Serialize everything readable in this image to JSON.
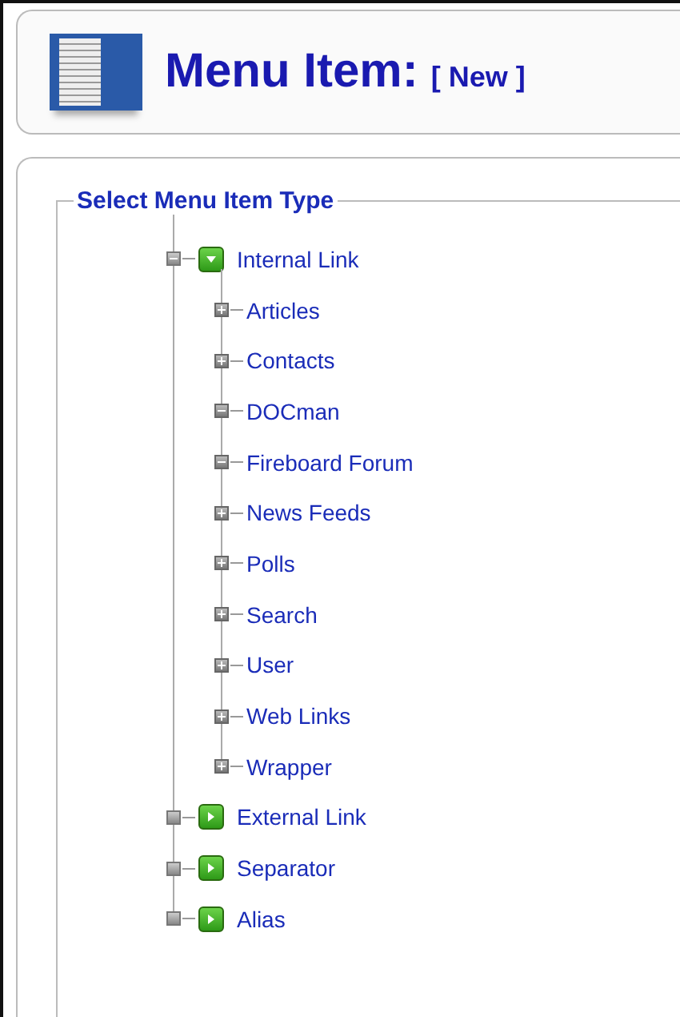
{
  "header": {
    "title": "Menu Item:",
    "subtitle": "[ New ]"
  },
  "legend": "Select Menu Item Type",
  "tree": [
    {
      "label": "Internal Link",
      "expanded": true,
      "children": [
        {
          "label": "Articles",
          "expanded": false
        },
        {
          "label": "Contacts",
          "expanded": false
        },
        {
          "label": "DOCman",
          "expanded": true
        },
        {
          "label": "Fireboard Forum",
          "expanded": true
        },
        {
          "label": "News Feeds",
          "expanded": false
        },
        {
          "label": "Polls",
          "expanded": false
        },
        {
          "label": "Search",
          "expanded": false
        },
        {
          "label": "User",
          "expanded": false
        },
        {
          "label": "Web Links",
          "expanded": false
        },
        {
          "label": "Wrapper",
          "expanded": false
        }
      ]
    },
    {
      "label": "External Link",
      "expanded": false
    },
    {
      "label": "Separator",
      "expanded": false
    },
    {
      "label": "Alias",
      "expanded": false
    }
  ]
}
